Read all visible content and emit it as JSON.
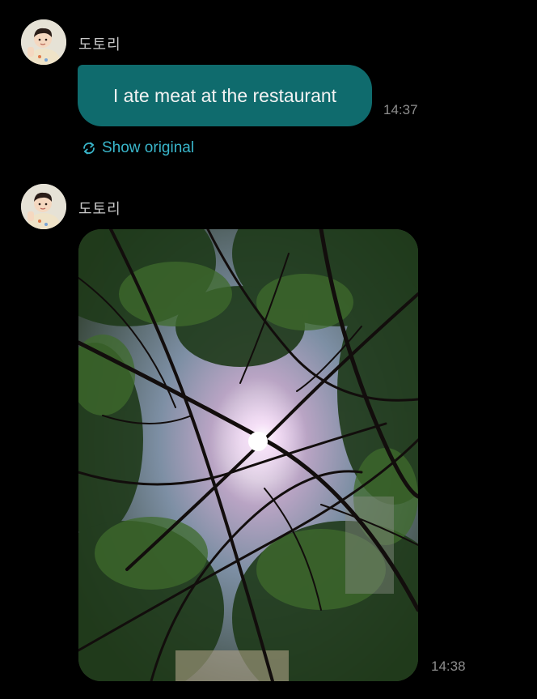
{
  "messages": [
    {
      "sender": "도토리",
      "avatar_icon": "user-avatar-icon",
      "text": "I ate meat at the restaurant",
      "time": "14:37",
      "bubble_color": "#0f6b6d",
      "show_original_label": "Show original",
      "show_original_icon": "translate-refresh-icon"
    },
    {
      "sender": "도토리",
      "avatar_icon": "user-avatar-icon",
      "attachment_icon": "photo-trees-sunlight-icon",
      "time": "14:38"
    }
  ],
  "colors": {
    "background": "#000000",
    "accent_link": "#39b6cb",
    "timestamp": "#8d8d8d",
    "sender_name": "#c9c9c9"
  }
}
